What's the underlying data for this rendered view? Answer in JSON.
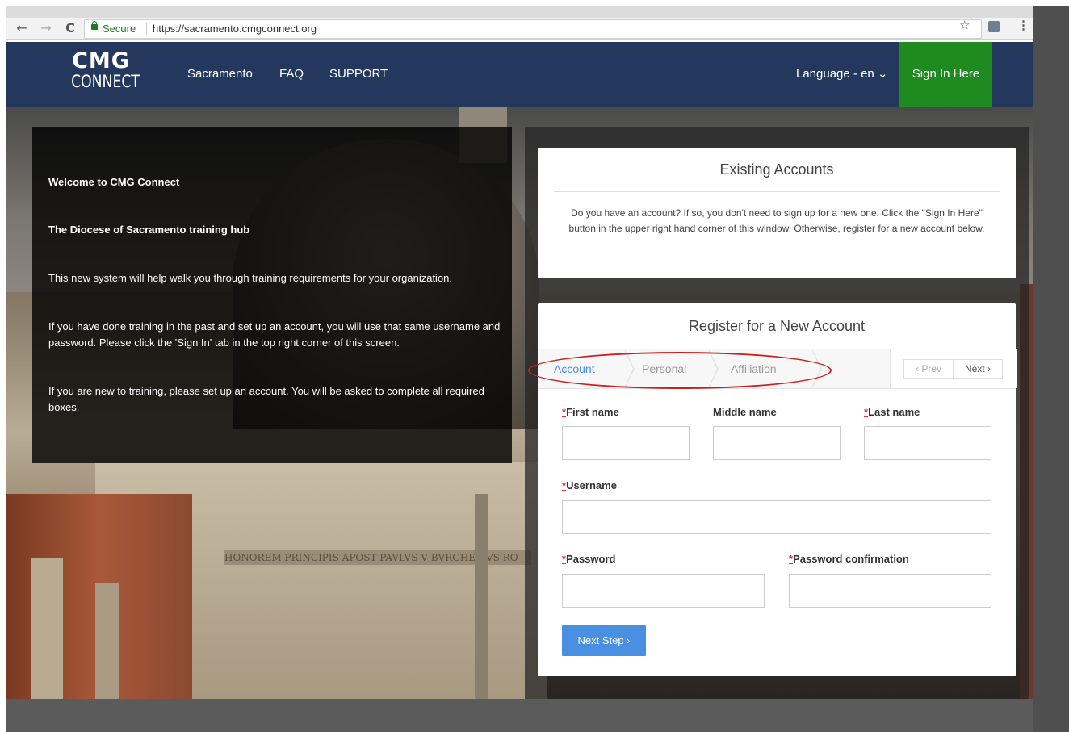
{
  "browser": {
    "back_icon": "←",
    "forward_icon": "→",
    "reload_icon": "C",
    "secure_label": "Secure",
    "url": "https://sacramento.cmgconnect.org",
    "star_icon": "☆",
    "menu_icon": "⋮"
  },
  "site_nav": {
    "logo_line1": "CMG",
    "logo_line2": "CONNECT",
    "links": [
      "Sacramento",
      "FAQ",
      "SUPPORT"
    ],
    "language": "Language - en ⌄",
    "sign_in": "Sign In Here",
    "colors": {
      "nav_bg": "#24385e",
      "sign_in_bg": "#1f8a1f"
    }
  },
  "hero_image": {
    "frieze_text": "HONOREM PRINCIPIS APOST PAVLVS V BVRGHESIVS RO"
  },
  "welcome": {
    "title": "Welcome to CMG Connect",
    "subtitle": "The Diocese of Sacramento training hub",
    "p1": "This new system will help walk you through training requirements for your organization.",
    "p2": "If you have done training in the past and set up an account, you will use that same username and password.  Please click the 'Sign In' tab in the top right corner of this screen.",
    "p3": "If you are new to training, please set up an account.  You will be asked to complete all required boxes."
  },
  "existing_accounts": {
    "title": "Existing Accounts",
    "text": "Do you have an account? If so, you don't need to sign up for a new one. Click the \"Sign In Here\" button in the upper right hand corner of this window. Otherwise, register for a new account below."
  },
  "register": {
    "title": "Register for a New Account",
    "tabs": [
      "Account",
      "Personal",
      "Affiliation"
    ],
    "active_tab": "Account",
    "prev": "‹  Prev",
    "next": "Next  ›",
    "required_mark": "*",
    "fields": {
      "first_name": "First name",
      "middle_name": "Middle name",
      "last_name": "Last name",
      "username": "Username",
      "password": "Password",
      "password_confirmation": "Password confirmation"
    },
    "next_step": "Next Step  ›",
    "colors": {
      "active_tab": "#4a90e2",
      "button": "#4a90e2",
      "required": "#dd3333"
    }
  }
}
